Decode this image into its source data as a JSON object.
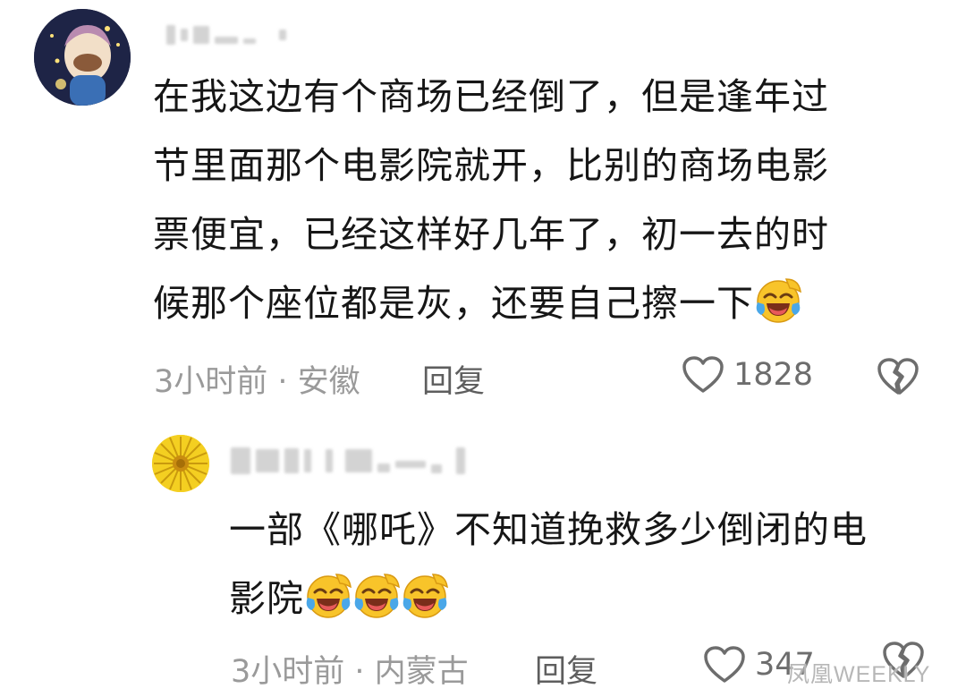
{
  "comments": [
    {
      "username": "",
      "text": "在我这边有个商场已经倒了，但是逢年过\n节里面那个电影院就开，比别的商场电影\n票便宜，已经这样好几年了，初一去的时\n候那个座位都是灰，还要自己擦一下",
      "emojis": [
        "laugh-cry"
      ],
      "meta": "3小时前 · 安徽",
      "reply_label": "回复",
      "likes": "1828"
    },
    {
      "username": "",
      "text": "一部《哪吒》不知道挽救多少倒闭的电\n影院",
      "emojis": [
        "laugh-cry",
        "laugh-cry",
        "laugh-cry"
      ],
      "meta": "3小时前 · 内蒙古",
      "reply_label": "回复",
      "likes": "347"
    }
  ],
  "watermark": "凤凰WEEKLY",
  "colors": {
    "text": "#161616",
    "meta": "#9a9a9a",
    "icon": "#6d6d6d",
    "emoji_face": "#f8c42a",
    "emoji_tears": "#4aa7e8"
  }
}
